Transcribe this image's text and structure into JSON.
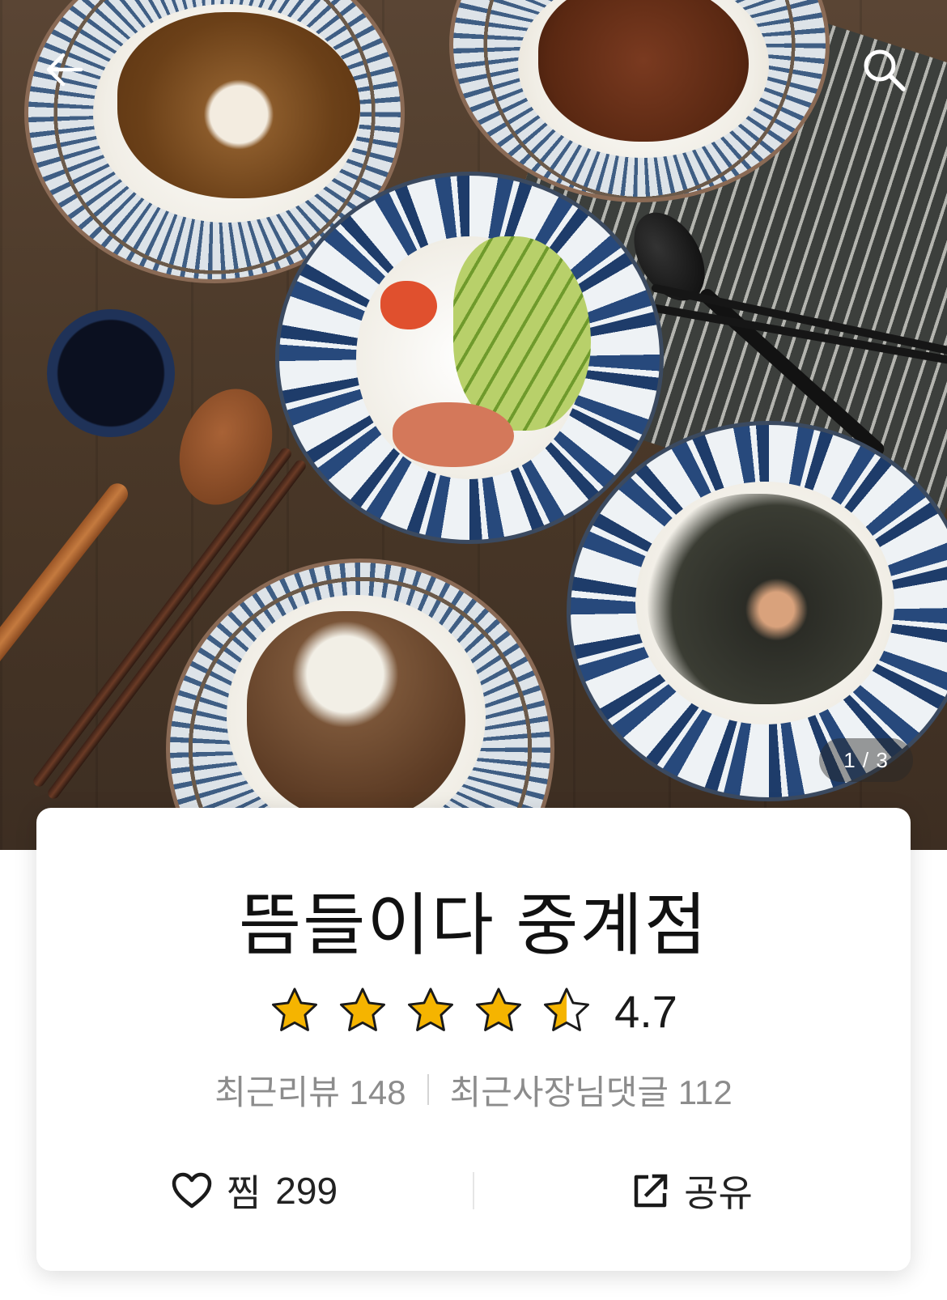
{
  "header": {
    "back_icon": "arrow-left-icon",
    "search_icon": "search-icon"
  },
  "gallery": {
    "current": 1,
    "total": 3,
    "counter_text": "1 / 3"
  },
  "store": {
    "name": "뜸들이다 중계점",
    "rating": {
      "value": "4.7",
      "score": 4.7,
      "max": 5,
      "star_color": "#f5b400"
    },
    "recent_review_label": "최근리뷰",
    "recent_review_count": "148",
    "owner_reply_label": "최근사장님댓글",
    "owner_reply_count": "112"
  },
  "actions": {
    "favorite_icon": "heart-outline-icon",
    "favorite_label": "찜",
    "favorite_count": "299",
    "share_icon": "share-icon",
    "share_label": "공유"
  }
}
